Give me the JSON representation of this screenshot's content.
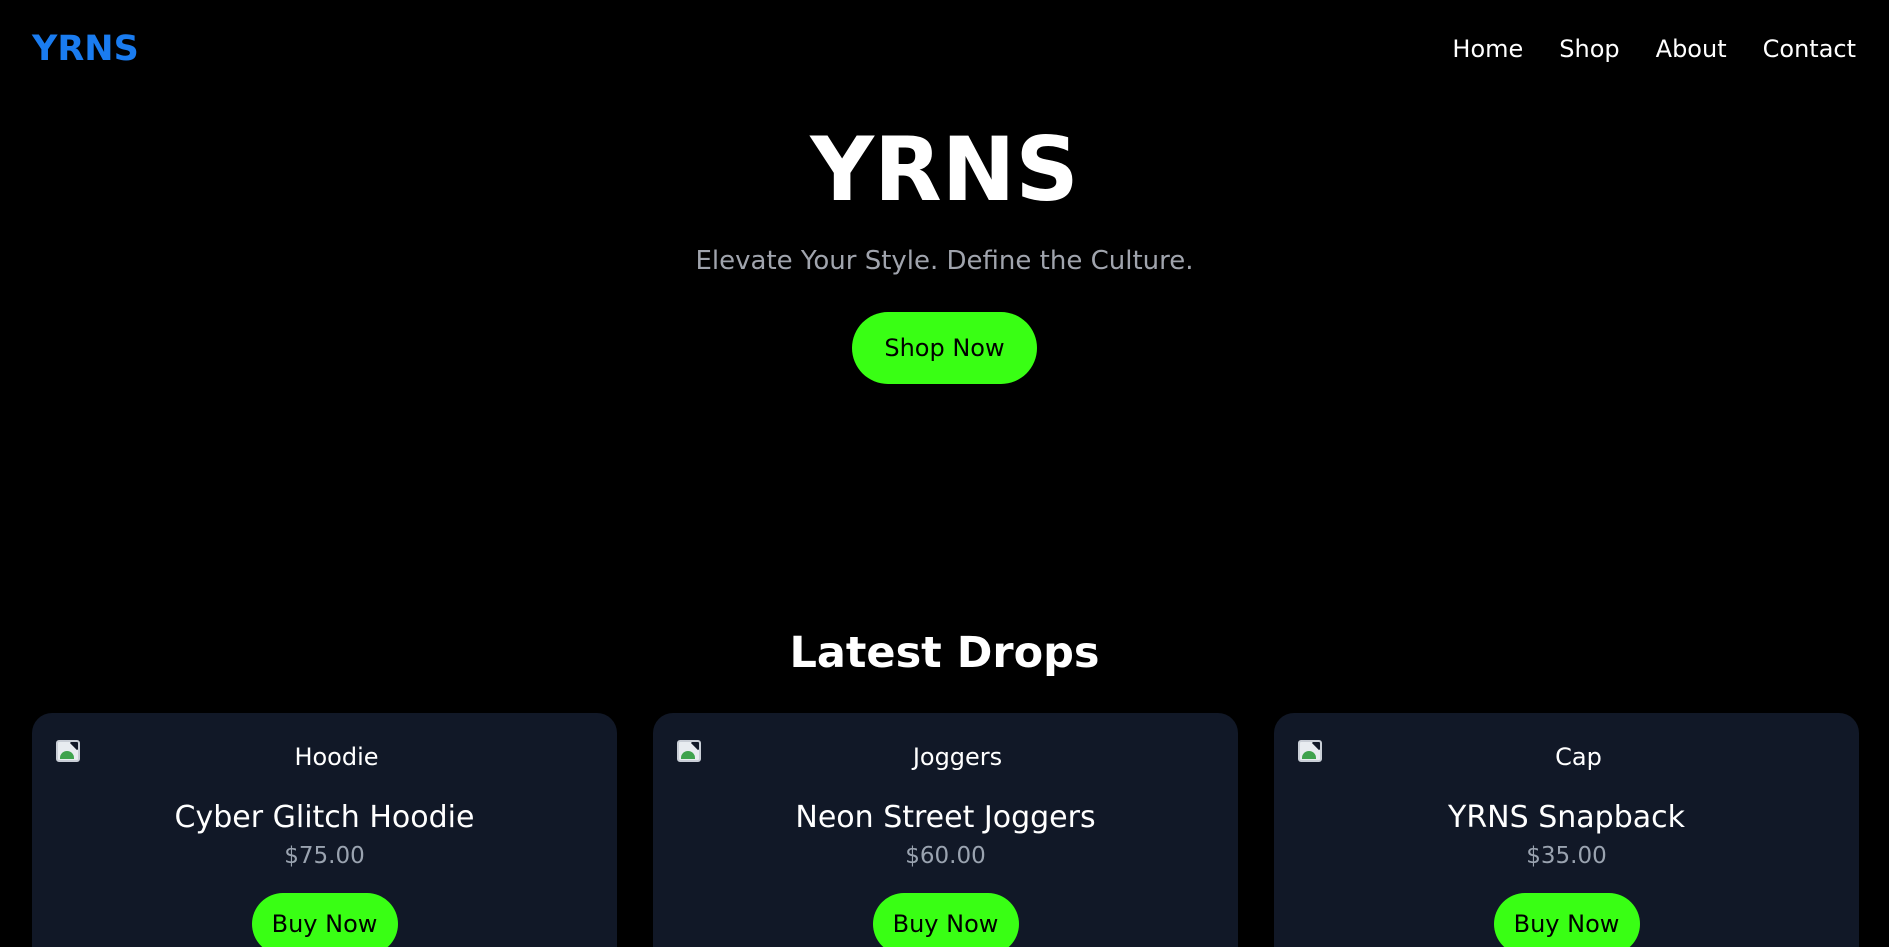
{
  "nav": {
    "logo": "YRNS",
    "links": [
      "Home",
      "Shop",
      "About",
      "Contact"
    ]
  },
  "hero": {
    "title": "YRNS",
    "subtitle": "Elevate Your Style. Define the Culture.",
    "cta_label": "Shop Now"
  },
  "section": {
    "title": "Latest Drops"
  },
  "products": [
    {
      "image_alt": "Hoodie",
      "name": "Cyber Glitch Hoodie",
      "price": "$75.00",
      "button_label": "Buy Now"
    },
    {
      "image_alt": "Joggers",
      "name": "Neon Street Joggers",
      "price": "$60.00",
      "button_label": "Buy Now"
    },
    {
      "image_alt": "Cap",
      "name": "YRNS Snapback",
      "price": "$35.00",
      "button_label": "Buy Now"
    }
  ],
  "colors": {
    "background": "#000000",
    "logo": "#1a7cf0",
    "accent": "#39ff14",
    "card": "#111827",
    "muted_text": "#9aa3b0"
  },
  "icons": {
    "product_image": "broken-image-icon"
  }
}
